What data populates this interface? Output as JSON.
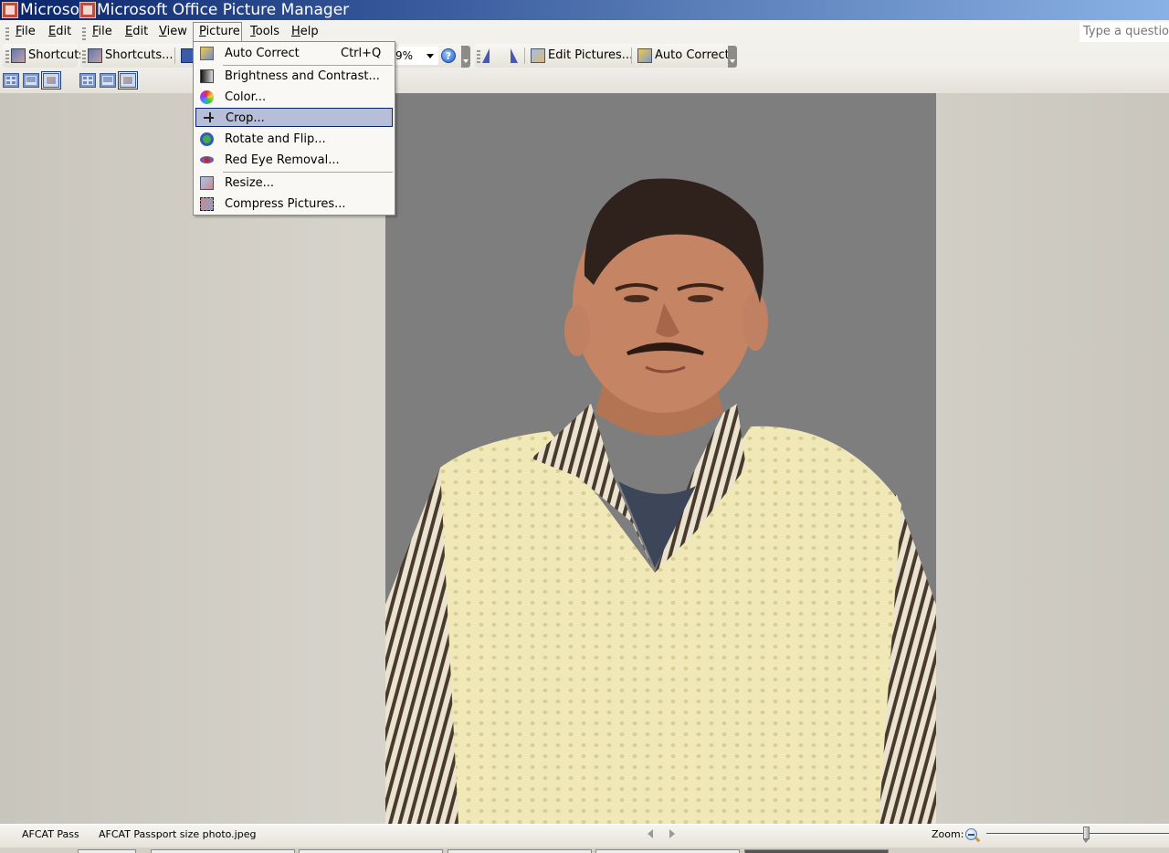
{
  "window": {
    "title_fragment": "Microso",
    "title": "Microsoft Office Picture Manager"
  },
  "menubar": {
    "items": [
      {
        "label": "File",
        "mnemonic": "F"
      },
      {
        "label": "Edit",
        "mnemonic": "E"
      },
      {
        "label": "File",
        "mnemonic": "F"
      },
      {
        "label": "Edit",
        "mnemonic": "E"
      },
      {
        "label": "View",
        "mnemonic": "V"
      },
      {
        "label": "Picture",
        "mnemonic": "P",
        "open": true
      },
      {
        "label": "Tools",
        "mnemonic": "T"
      },
      {
        "label": "Help",
        "mnemonic": "H"
      }
    ],
    "ask_placeholder": "Type a question"
  },
  "toolbar": {
    "shortcuts_truncated": "Shortcuts",
    "shortcuts": "Shortcuts...",
    "zoom_value": "9%",
    "edit_pictures": "Edit Pictures...",
    "auto_correct": "Auto Correct",
    "icons": [
      "shortcuts-icon",
      "save-icon",
      "help-icon",
      "rotate-left-icon",
      "rotate-right-icon",
      "edit-pictures-icon",
      "auto-correct-icon"
    ]
  },
  "view_buttons": [
    {
      "name": "thumbnail-view",
      "selected": false
    },
    {
      "name": "filmstrip-view",
      "selected": false
    },
    {
      "name": "single-picture-view",
      "selected": true
    },
    {
      "name": "thumbnail-view",
      "selected": false
    },
    {
      "name": "filmstrip-view",
      "selected": false
    },
    {
      "name": "single-picture-view",
      "selected": true
    }
  ],
  "picture_menu": {
    "items": [
      {
        "label": "Auto Correct",
        "shortcut": "Ctrl+Q",
        "icon": "auto-correct-icon"
      },
      {
        "label": "Brightness and Contrast...",
        "icon": "brightness-icon"
      },
      {
        "label": "Color...",
        "icon": "color-wheel-icon"
      },
      {
        "label": "Crop...",
        "icon": "crop-icon",
        "highlighted": true
      },
      {
        "label": "Rotate and Flip...",
        "icon": "rotate-icon"
      },
      {
        "label": "Red Eye Removal...",
        "icon": "red-eye-icon"
      },
      {
        "label": "Resize...",
        "icon": "resize-icon"
      },
      {
        "label": "Compress Pictures...",
        "icon": "compress-icon"
      }
    ]
  },
  "photo": {
    "description": "Passport-size portrait photo on grey background",
    "background_color": "#7e7e7e"
  },
  "statusbar": {
    "file_truncated": "AFCAT Pass|",
    "file_name": "AFCAT Passport size photo.jpeg",
    "zoom_label": "Zoom:",
    "zoom_slider_fraction": 0.55
  },
  "colors": {
    "title_gradient_start": "#0a246a",
    "title_gradient_end": "#8ab1e6",
    "menu_highlight": "#b7bed8",
    "menu_highlight_border": "#0a246a"
  }
}
